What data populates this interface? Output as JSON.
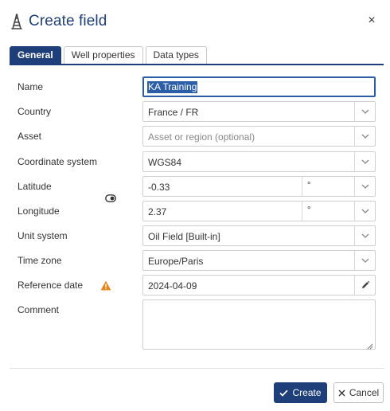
{
  "dialog": {
    "title": "Create field",
    "close_symbol": "×",
    "logo_icon": "oil-derrick-icon"
  },
  "tabs": [
    {
      "label": "General",
      "active": true
    },
    {
      "label": "Well properties",
      "active": false
    },
    {
      "label": "Data types",
      "active": false
    }
  ],
  "form": {
    "name": {
      "label": "Name",
      "value": "KA Training"
    },
    "country": {
      "label": "Country",
      "value": "France / FR"
    },
    "asset": {
      "label": "Asset",
      "placeholder": "Asset or region (optional)"
    },
    "coordinate_system": {
      "label": "Coordinate system",
      "value": "WGS84"
    },
    "latitude": {
      "label": "Latitude",
      "value": "-0.33",
      "unit": "°"
    },
    "longitude": {
      "label": "Longitude",
      "value": "2.37",
      "unit": "°"
    },
    "unit_system": {
      "label": "Unit system",
      "value": "Oil Field [Built-in]"
    },
    "time_zone": {
      "label": "Time zone",
      "value": "Europe/Paris"
    },
    "reference_date": {
      "label": "Reference date",
      "value": "2024-04-09"
    },
    "comment": {
      "label": "Comment",
      "value": ""
    }
  },
  "footer": {
    "create_label": "Create",
    "cancel_label": "Cancel"
  },
  "colors": {
    "accent": "#1f3f7a",
    "selection": "#2c5ea8",
    "warning": "#e8841a"
  }
}
